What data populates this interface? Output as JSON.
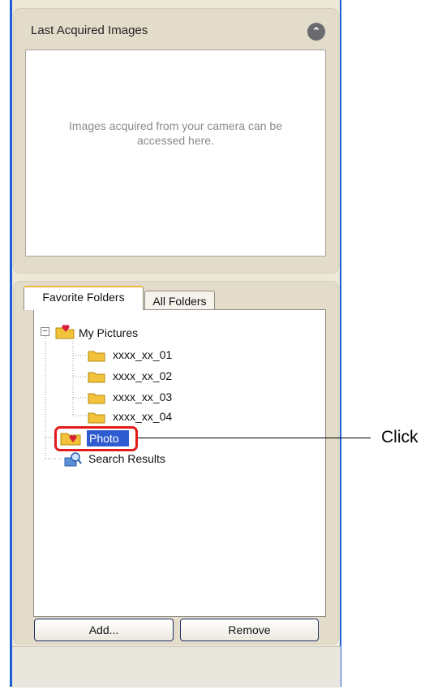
{
  "panel_last": {
    "title": "Last Acquired Images",
    "collapse_glyph": "⌃",
    "empty_text": "Images acquired from your camera can be accessed here."
  },
  "tabs": [
    {
      "label": "Favorite Folders",
      "active": true
    },
    {
      "label": "All Folders",
      "active": false
    }
  ],
  "tree": {
    "expander_glyph": "−",
    "root": "My Pictures",
    "children": [
      "xxxx_xx_01",
      "xxxx_xx_02",
      "xxxx_xx_03",
      "xxxx_xx_04"
    ],
    "favorite": "Photo",
    "search": "Search Results"
  },
  "buttons": {
    "add": "Add...",
    "remove": "Remove"
  },
  "annotation": {
    "label": "Click",
    "color": "#e01b1b"
  },
  "colors": {
    "window_frame": "#1f5fd6",
    "selection": "#2f5bd0",
    "folder": "#f2c23a"
  }
}
